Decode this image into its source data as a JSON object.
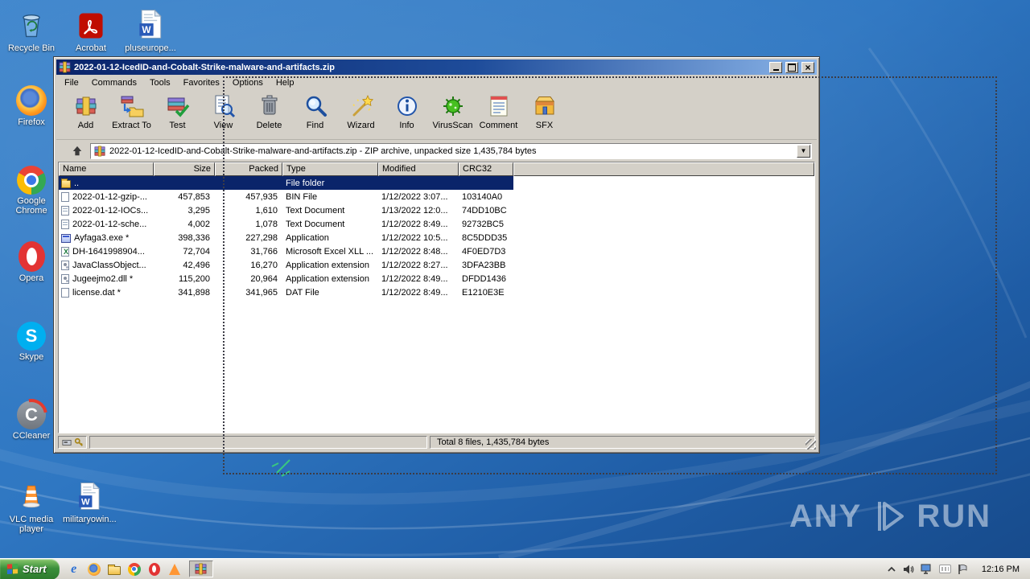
{
  "desktop": {
    "icons": [
      {
        "label": "Recycle Bin",
        "icon": "recycle-bin"
      },
      {
        "label": "Acrobat",
        "icon": "acrobat"
      },
      {
        "label": "pluseurope...",
        "icon": "word-document"
      },
      {
        "label": "Firefox",
        "icon": "firefox"
      },
      {
        "label": "Google Chrome",
        "icon": "chrome"
      },
      {
        "label": "Opera",
        "icon": "opera"
      },
      {
        "label": "Skype",
        "icon": "skype"
      },
      {
        "label": "CCleaner",
        "icon": "ccleaner"
      },
      {
        "label": "VLC media player",
        "icon": "vlc"
      },
      {
        "label": "militaryowin...",
        "icon": "word-document"
      }
    ],
    "watermark": {
      "any": "ANY",
      "run": "RUN"
    }
  },
  "winrar": {
    "title": "2022-01-12-IcedID-and-Cobalt-Strike-malware-and-artifacts.zip",
    "menu": [
      "File",
      "Commands",
      "Tools",
      "Favorites",
      "Options",
      "Help"
    ],
    "toolbar": [
      {
        "label": "Add",
        "icon": "add-archive-icon"
      },
      {
        "label": "Extract To",
        "icon": "extract-to-icon"
      },
      {
        "label": "Test",
        "icon": "test-archive-icon"
      },
      {
        "label": "View",
        "icon": "view-file-icon"
      },
      {
        "label": "Delete",
        "icon": "delete-icon"
      },
      {
        "label": "Find",
        "icon": "find-icon"
      },
      {
        "label": "Wizard",
        "icon": "wizard-icon"
      },
      {
        "label": "Info",
        "icon": "info-icon"
      },
      {
        "label": "VirusScan",
        "icon": "virus-scan-icon"
      },
      {
        "label": "Comment",
        "icon": "comment-icon"
      },
      {
        "label": "SFX",
        "icon": "sfx-icon"
      }
    ],
    "address": "2022-01-12-IcedID-and-Cobalt-Strike-malware-and-artifacts.zip - ZIP archive, unpacked size 1,435,784 bytes",
    "columns": [
      "Name",
      "Size",
      "Packed",
      "Type",
      "Modified",
      "CRC32"
    ],
    "rows": [
      {
        "name": "..",
        "size": "",
        "packed": "",
        "type": "File folder",
        "modified": "",
        "crc32": "",
        "icon": "folder",
        "selected": true
      },
      {
        "name": "2022-01-12-gzip-...",
        "size": "457,853",
        "packed": "457,935",
        "type": "BIN File",
        "modified": "1/12/2022 3:07...",
        "crc32": "103140A0",
        "icon": "file"
      },
      {
        "name": "2022-01-12-IOCs...",
        "size": "3,295",
        "packed": "1,610",
        "type": "Text Document",
        "modified": "1/13/2022 12:0...",
        "crc32": "74DD10BC",
        "icon": "text"
      },
      {
        "name": "2022-01-12-sche...",
        "size": "4,002",
        "packed": "1,078",
        "type": "Text Document",
        "modified": "1/12/2022 8:49...",
        "crc32": "92732BC5",
        "icon": "text"
      },
      {
        "name": "Ayfaga3.exe *",
        "size": "398,336",
        "packed": "227,298",
        "type": "Application",
        "modified": "1/12/2022 10:5...",
        "crc32": "8C5DDD35",
        "icon": "application"
      },
      {
        "name": "DH-1641998904...",
        "size": "72,704",
        "packed": "31,766",
        "type": "Microsoft Excel XLL ...",
        "modified": "1/12/2022 8:48...",
        "crc32": "4F0ED7D3",
        "icon": "excel"
      },
      {
        "name": "JavaClassObject...",
        "size": "42,496",
        "packed": "16,270",
        "type": "Application extension",
        "modified": "1/12/2022 8:27...",
        "crc32": "3DFA23BB",
        "icon": "dll"
      },
      {
        "name": "Jugeejmo2.dll *",
        "size": "115,200",
        "packed": "20,964",
        "type": "Application extension",
        "modified": "1/12/2022 8:49...",
        "crc32": "DFDD1436",
        "icon": "dll"
      },
      {
        "name": "license.dat *",
        "size": "341,898",
        "packed": "341,965",
        "type": "DAT File",
        "modified": "1/12/2022 8:49...",
        "crc32": "E1210E3E",
        "icon": "file"
      }
    ],
    "status_total": "Total 8 files, 1,435,784 bytes"
  },
  "taskbar": {
    "start_label": "Start",
    "clock": "12:16 PM"
  }
}
